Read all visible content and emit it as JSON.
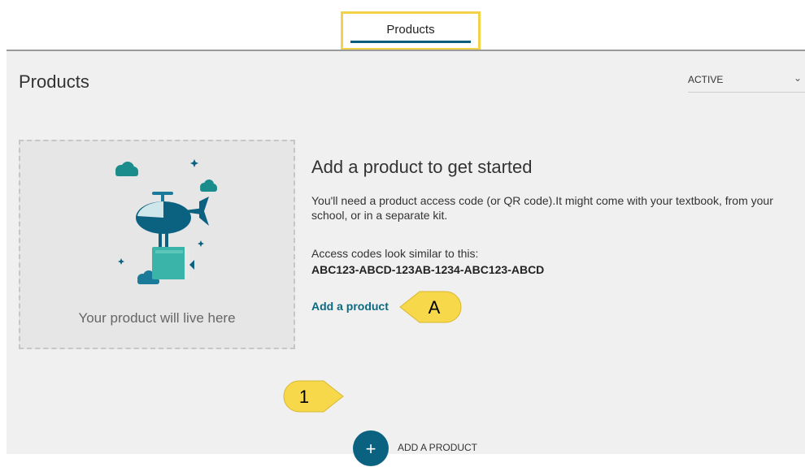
{
  "tabs": {
    "active_label": "Products"
  },
  "header": {
    "title": "Products"
  },
  "filter": {
    "selected": "ACTIVE",
    "chevron_icon": "chevron-down-icon"
  },
  "placeholder": {
    "caption": "Your product will live here",
    "illustration_icon": "helicopter-delivery-icon"
  },
  "info": {
    "heading": "Add a product to get started",
    "intro": "You'll need a product access code (or QR code).It might come with your textbook, from your school, or in a separate kit.",
    "example_label": "Access codes look similar to this:",
    "example_code": "ABC123-ABCD-123AB-1234-ABC123-ABCD",
    "add_link": "Add a product"
  },
  "callouts": {
    "a_label": "A",
    "one_label": "1"
  },
  "add_button": {
    "icon": "+",
    "label": "ADD A PRODUCT"
  },
  "colors": {
    "accent": "#0b6280",
    "callout": "#f2d348",
    "tab_highlight": "#f2d348",
    "panel_bg": "#f0f0f0"
  }
}
